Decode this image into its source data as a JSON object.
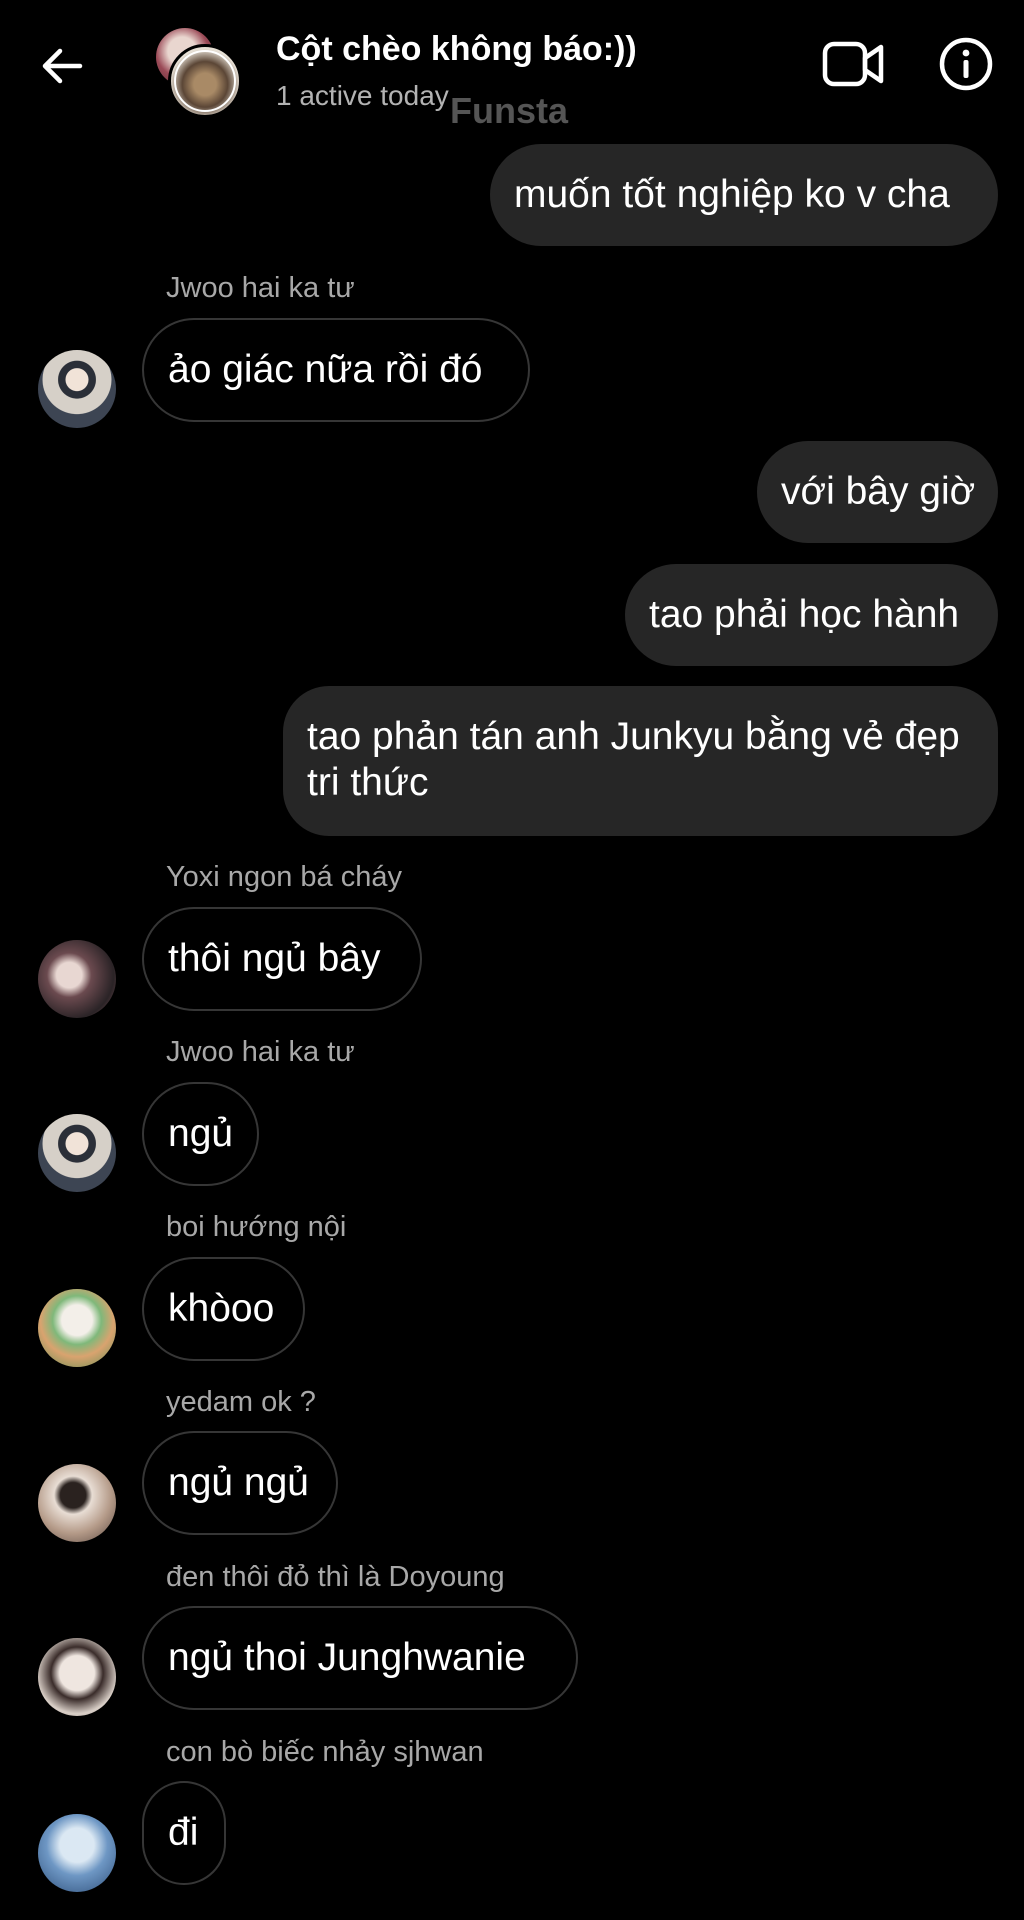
{
  "header": {
    "title": "Cột chèo không báo:))",
    "status": "1 active today",
    "watermark": "Funsta",
    "icons": {
      "back": "arrow-left-icon",
      "video": "video-camera-icon",
      "info": "info-icon"
    }
  },
  "messages": [
    {
      "direction": "sent",
      "text": "muốn tốt nghiệp ko v cha"
    },
    {
      "direction": "received",
      "sender": "Jwoo hai ka tư",
      "text": "ảo giác nữa rồi đó"
    },
    {
      "direction": "sent",
      "text": "với bây giờ"
    },
    {
      "direction": "sent",
      "text": "tao phải học hành"
    },
    {
      "direction": "sent",
      "text": "tao phản tán anh Junkyu bằng vẻ đẹp tri thức"
    },
    {
      "direction": "received",
      "sender": "Yoxi ngon bá cháy",
      "text": "thôi ngủ bây"
    },
    {
      "direction": "received",
      "sender": "Jwoo hai ka tư",
      "text": "ngủ"
    },
    {
      "direction": "received",
      "sender": "boi hướng nội",
      "text": "khòoo"
    },
    {
      "direction": "received",
      "sender": "yedam ok ?",
      "text": "ngủ ngủ"
    },
    {
      "direction": "received",
      "sender": "đen thôi đỏ thì là Doyoung",
      "text": "ngủ thoi Junghwanie"
    },
    {
      "direction": "received",
      "sender": "con bò biếc nhảy sjhwan",
      "text": "đi"
    }
  ],
  "colors": {
    "background": "#000000",
    "sent_bubble": "#262626",
    "received_border": "#363636",
    "sender_text": "#a8a8a8"
  }
}
